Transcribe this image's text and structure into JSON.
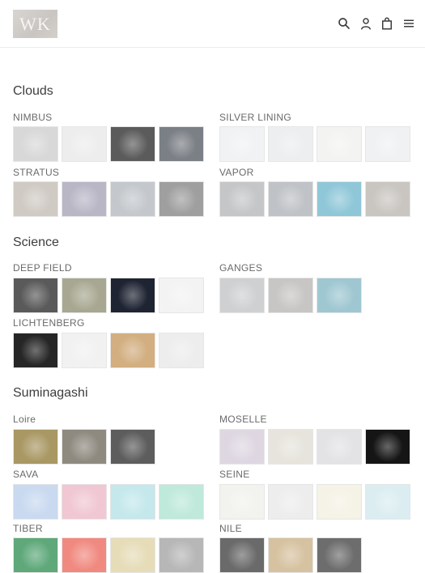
{
  "brand": {
    "logo_text": "WK"
  },
  "header": {
    "icons": [
      "search-icon",
      "account-icon",
      "cart-icon",
      "menu-icon"
    ]
  },
  "sections": [
    {
      "title": "Clouds",
      "groups": [
        {
          "name": "NIMBUS",
          "colors": [
            "#d8d8d8",
            "#ededed",
            "#5b5b5b",
            "#7b7f86"
          ]
        },
        {
          "name": "SILVER LINING",
          "colors": [
            "#f1f2f3",
            "#eceeef",
            "#f3f4f2",
            "#f0f1f3"
          ]
        },
        {
          "name": "STRATUS",
          "colors": [
            "#cfcac3",
            "#b9b7c6",
            "#c4c8cc",
            "#9f9f9f"
          ]
        },
        {
          "name": "VAPOR",
          "colors": [
            "#c4c6c8",
            "#bfc2c6",
            "#8fc7d8",
            "#c9c6c1"
          ]
        }
      ]
    },
    {
      "title": "Science",
      "groups": [
        {
          "name": "DEEP FIELD",
          "colors": [
            "#5a5a5a",
            "#a8a892",
            "#1f2433",
            "#f3f3f3"
          ]
        },
        {
          "name": "GANGES",
          "colors": [
            "#cfd0d2",
            "#c8c6c4",
            "#9fc7d1"
          ]
        },
        {
          "name": "LICHTENBERG",
          "colors": [
            "#262626",
            "#f1f1f1",
            "#d2ae80",
            "#ededed"
          ]
        }
      ]
    },
    {
      "title": "Suminagashi",
      "groups": [
        {
          "name": "Loire",
          "colors": [
            "#a99864",
            "#8f8a80",
            "#5d5d5d"
          ]
        },
        {
          "name": "MOSELLE",
          "colors": [
            "#ded7e2",
            "#e6e4dc",
            "#e3e3e6",
            "#151515"
          ]
        },
        {
          "name": "SAVA",
          "colors": [
            "#c9d9f0",
            "#f0c7d2",
            "#c4e8ec",
            "#bfe9da"
          ]
        },
        {
          "name": "SEINE",
          "colors": [
            "#f2f2ee",
            "#ededee",
            "#f5f2e6",
            "#dbedf1"
          ]
        },
        {
          "name": "TIBER",
          "colors": [
            "#5ea87a",
            "#f08a80",
            "#e6dcb8",
            "#b7b7b7"
          ]
        },
        {
          "name": "NILE",
          "colors": [
            "#6a6a6a",
            "#d6c2a0",
            "#6d6d6d"
          ]
        }
      ]
    }
  ]
}
